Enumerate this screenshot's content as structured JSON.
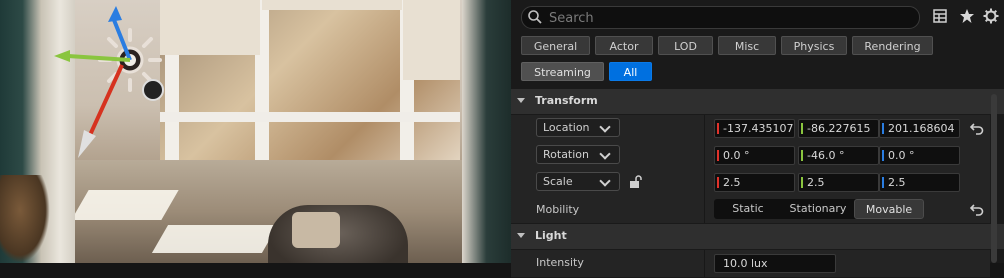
{
  "search": {
    "placeholder": "Search"
  },
  "filters": {
    "general": "General",
    "actor": "Actor",
    "lod": "LOD",
    "misc": "Misc",
    "physics": "Physics",
    "rendering": "Rendering",
    "streaming": "Streaming",
    "all": "All"
  },
  "transform": {
    "header": "Transform",
    "location": {
      "label": "Location",
      "x": "-137.435107",
      "y": "-86.227615",
      "z": "201.168604"
    },
    "rotation": {
      "label": "Rotation",
      "x": "0.0 °",
      "y": "-46.0 °",
      "z": "0.0 °"
    },
    "scale": {
      "label": "Scale",
      "x": "2.5",
      "y": "2.5",
      "z": "2.5"
    },
    "mobility": {
      "label": "Mobility",
      "options": [
        "Static",
        "Stationary",
        "Movable"
      ],
      "selected": "Movable"
    }
  },
  "light": {
    "header": "Light",
    "intensity_label": "Intensity",
    "intensity_value": "10.0 lux"
  },
  "colors": {
    "axis_x": "#e0322b",
    "axis_y": "#8ac53f",
    "axis_z": "#2a7de1",
    "accent": "#0070e0"
  },
  "icons": [
    "search-icon",
    "table-icon",
    "star-icon",
    "gear-icon",
    "reset-arrow-icon",
    "lock-open-icon",
    "chevron-down-icon"
  ]
}
